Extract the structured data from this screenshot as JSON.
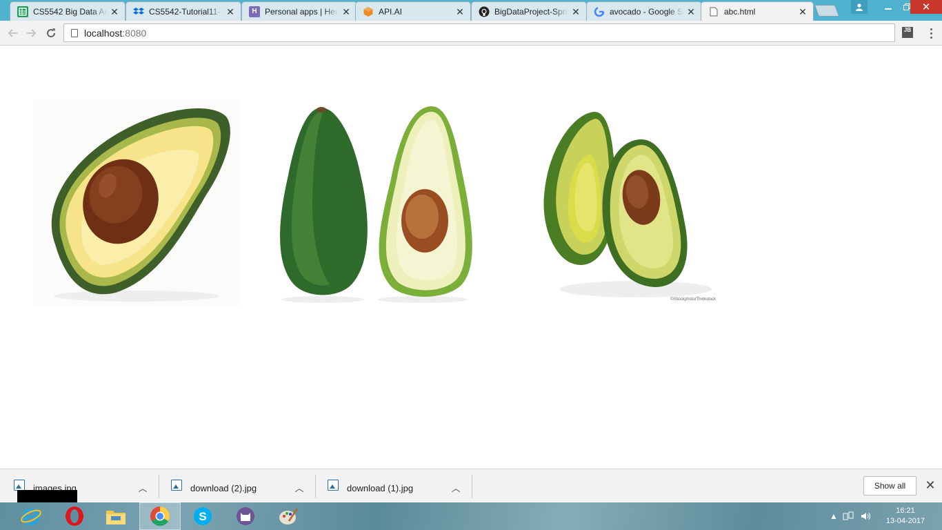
{
  "browser": {
    "tabs": [
      {
        "title": "CS5542 Big Data An",
        "icon": "sheets-icon",
        "active": false
      },
      {
        "title": "CS5542-Tutorial11-",
        "icon": "dropbox-icon",
        "active": false
      },
      {
        "title": "Personal apps | Hero",
        "icon": "heroku-icon",
        "active": false
      },
      {
        "title": "API.AI",
        "icon": "api-ai-icon",
        "active": false
      },
      {
        "title": "BigDataProject-Spri",
        "icon": "github-icon",
        "active": false
      },
      {
        "title": "avocado - Google S",
        "icon": "google-icon",
        "active": false
      },
      {
        "title": "abc.html",
        "icon": "page-icon",
        "active": true
      }
    ],
    "address": {
      "host": "localhost",
      "port": ":8080"
    },
    "extension_label": "JB"
  },
  "page": {
    "images": [
      {
        "alt": "avocado half with pit"
      },
      {
        "alt": "whole avocado and halved avocado"
      },
      {
        "alt": "two avocado halves"
      }
    ],
    "watermark": "©iStockphoto/Thinkstock"
  },
  "downloads": {
    "items": [
      {
        "name": "images.jpg"
      },
      {
        "name": "download (2).jpg"
      },
      {
        "name": "download (1).jpg"
      }
    ],
    "show_all_label": "Show all"
  },
  "taskbar": {
    "apps": [
      "internet-explorer-icon",
      "opera-icon",
      "file-explorer-icon",
      "chrome-icon",
      "skype-icon",
      "github-desktop-icon",
      "paint-icon"
    ],
    "active_app": "chrome-icon",
    "time": "16:21",
    "date": "13-04-2017"
  },
  "colors": {
    "tabstrip": "#4fb3d0",
    "toolbar": "#f2f2f2",
    "avocado_skin": "#3f6e2a",
    "avocado_flesh": "#f6e58a",
    "avocado_pit": "#7a3a1c"
  }
}
